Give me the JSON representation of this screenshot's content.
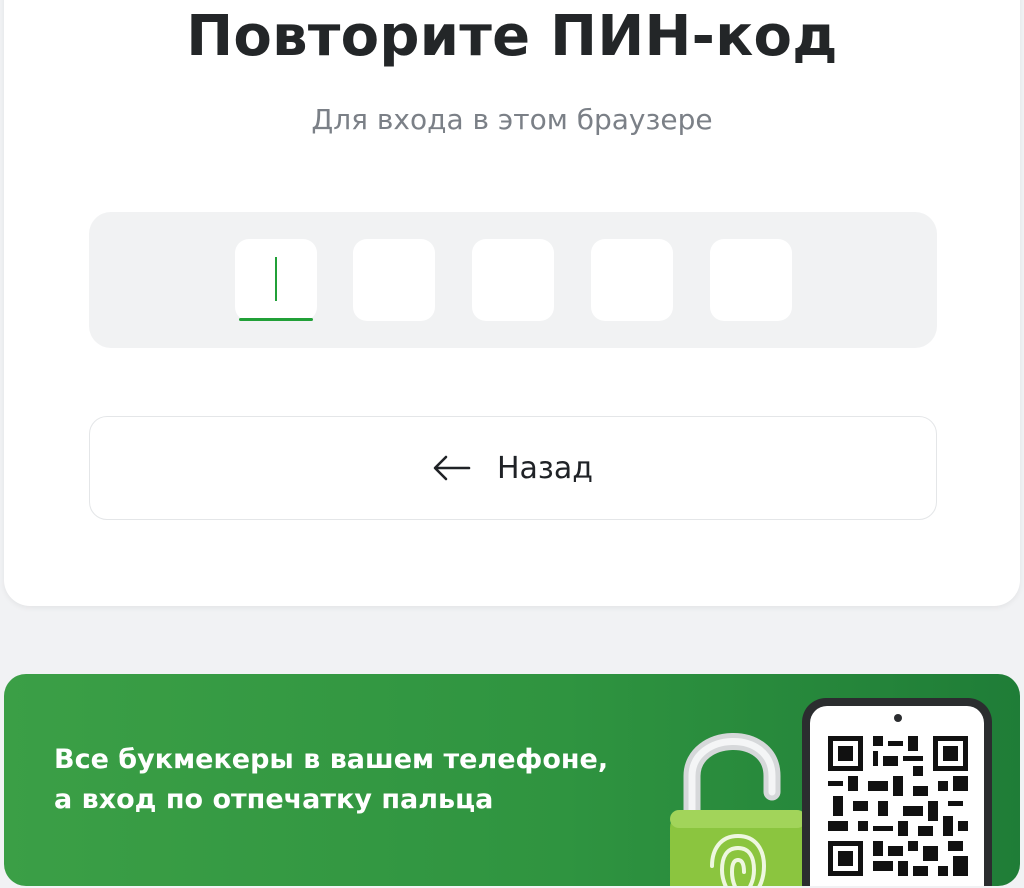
{
  "pin_screen": {
    "title": "Повторите ПИН-код",
    "subtitle": "Для входа в этом браузере",
    "pin_length": 5,
    "filled_digits": 0,
    "back_button_label": "Назад",
    "back_icon": "arrow-left-icon"
  },
  "promo_banner": {
    "line1": "Все букмекеры в вашем телефоне,",
    "line2": "а вход по отпечатку пальца",
    "lock_icon": "fingerprint-lock-icon",
    "qr_icon": "qr-code-icon"
  },
  "colors": {
    "accent": "#21a038",
    "banner_green": "#2f9440",
    "text_dark": "#232628",
    "text_muted": "#7b8087"
  }
}
